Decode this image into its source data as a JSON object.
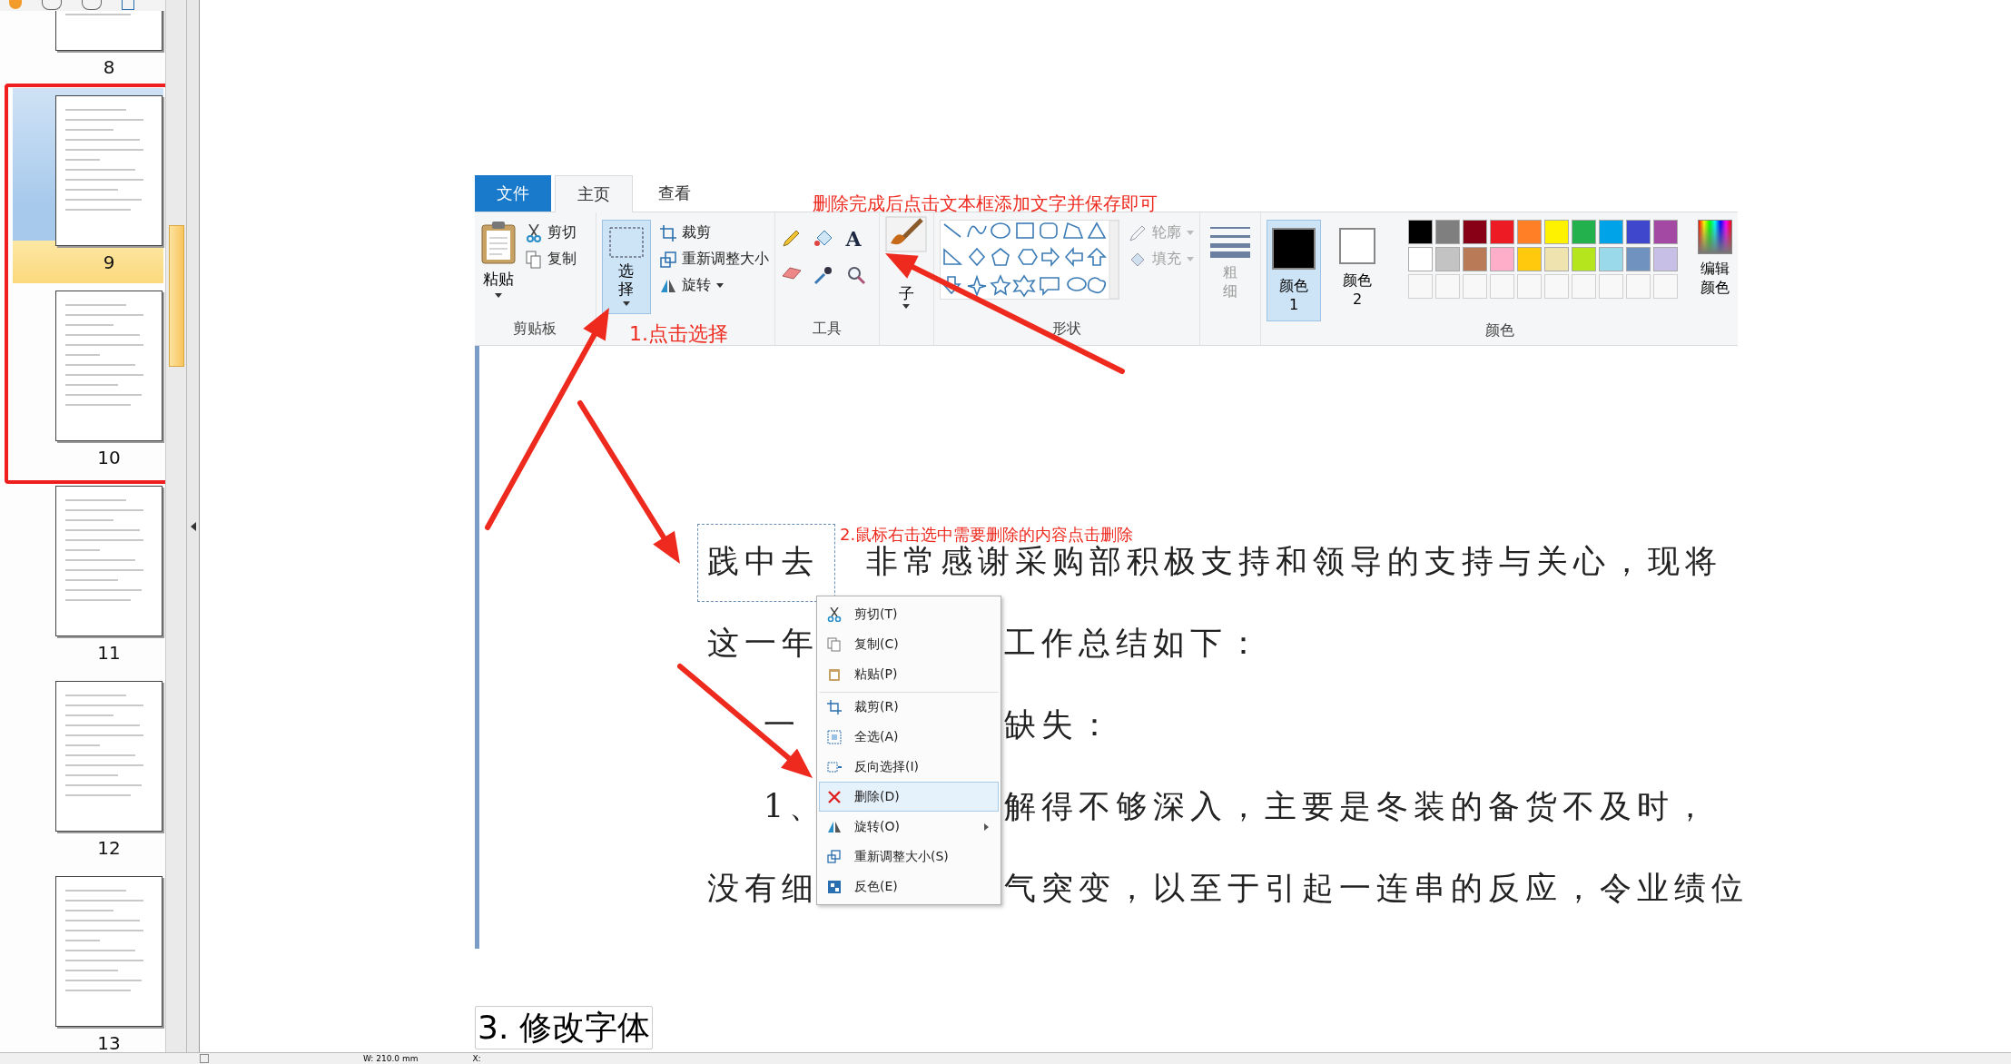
{
  "sidebar": {
    "thumbnails": [
      {
        "label": "8",
        "selected": false
      },
      {
        "label": "9",
        "selected": true
      },
      {
        "label": "10",
        "selected": false
      },
      {
        "label": "11",
        "selected": false
      },
      {
        "label": "12",
        "selected": false
      },
      {
        "label": "13",
        "selected": false
      }
    ]
  },
  "paint": {
    "tabs": [
      {
        "label": "文件",
        "kind": "file",
        "selected": false
      },
      {
        "label": "主页",
        "kind": "tab",
        "selected": true
      },
      {
        "label": "查看",
        "kind": "tab",
        "selected": false
      }
    ],
    "paste": "粘贴",
    "cut": "剪切",
    "copy": "复制",
    "clipboard_group": "剪贴板",
    "select": "选择",
    "crop": "裁剪",
    "resize": "重新调整大小",
    "rotate": "旋转",
    "text_tool": "A",
    "tools_group": "工具",
    "brush": "子",
    "shapes_group": "形状",
    "outline": "轮廓",
    "fill": "填充",
    "size": "粗细",
    "color1": {
      "label": "颜色 1",
      "color": "#000000",
      "selected": true
    },
    "color2": {
      "label": "颜色 2",
      "color": "#ffffff",
      "selected": false
    },
    "palette": [
      {
        "color": "#000000"
      },
      {
        "color": "#7f7f7f"
      },
      {
        "color": "#880015"
      },
      {
        "color": "#ed1c24"
      },
      {
        "color": "#ff7f27"
      },
      {
        "color": "#fff200"
      },
      {
        "color": "#22b14c"
      },
      {
        "color": "#00a2e8"
      },
      {
        "color": "#3f48cc"
      },
      {
        "color": "#a349a4"
      },
      {
        "color": "#ffffff"
      },
      {
        "color": "#c3c3c3"
      },
      {
        "color": "#b97a57"
      },
      {
        "color": "#ffaec9"
      },
      {
        "color": "#ffc90e"
      },
      {
        "color": "#efe4b0"
      },
      {
        "color": "#b5e61d"
      },
      {
        "color": "#99d9ea"
      },
      {
        "color": "#7092be"
      },
      {
        "color": "#c8bfe7"
      }
    ],
    "edit_colors": "编辑颜色",
    "colors_group": "颜色",
    "document_lines": [
      {
        "left": "践中去",
        "right": "非常感谢采购部积极支持和领导的支持与关心，现将"
      },
      {
        "left": "这一年",
        "right": "工作总结如下："
      },
      {
        "left": "一",
        "right": "缺失："
      },
      {
        "left": "1、",
        "right": "解得不够深入，主要是冬装的备货不及时，"
      },
      {
        "left": "没有细",
        "right": "气突变，以至于引起一连串的反应，令业绩位"
      }
    ],
    "context_menu": [
      {
        "label": "剪切(T)",
        "kind": "cut",
        "selected": false,
        "separator": false,
        "submenu": false
      },
      {
        "label": "复制(C)",
        "kind": "copy",
        "selected": false,
        "separator": false,
        "submenu": false
      },
      {
        "label": "粘贴(P)",
        "kind": "paste",
        "selected": false,
        "separator": false,
        "submenu": false
      },
      {
        "label": "裁剪(R)",
        "kind": "crop",
        "selected": false,
        "separator": true,
        "submenu": false
      },
      {
        "label": "全选(A)",
        "kind": "selectall",
        "selected": false,
        "separator": false,
        "submenu": false
      },
      {
        "label": "反向选择(I)",
        "kind": "invert",
        "selected": false,
        "separator": false,
        "submenu": false
      },
      {
        "label": "删除(D)",
        "kind": "delete",
        "selected": true,
        "separator": false,
        "submenu": false
      },
      {
        "label": "旋转(O)",
        "kind": "rotate",
        "selected": false,
        "separator": false,
        "submenu": true
      },
      {
        "label": "重新调整大小(S)",
        "kind": "resize",
        "selected": false,
        "separator": false,
        "submenu": false
      },
      {
        "label": "反色(E)",
        "kind": "invertcolor",
        "selected": false,
        "separator": false,
        "submenu": false
      }
    ],
    "annotations": {
      "top": "删除完成后点击文本框添加文字并保存即可",
      "step1": "1.点击选择",
      "step2": "2.鼠标右击选中需要删除的内容点击删除"
    }
  },
  "heading": "3.  修改字体",
  "status_bar": {
    "width": "W: 210.0 mm",
    "x": "X:"
  }
}
